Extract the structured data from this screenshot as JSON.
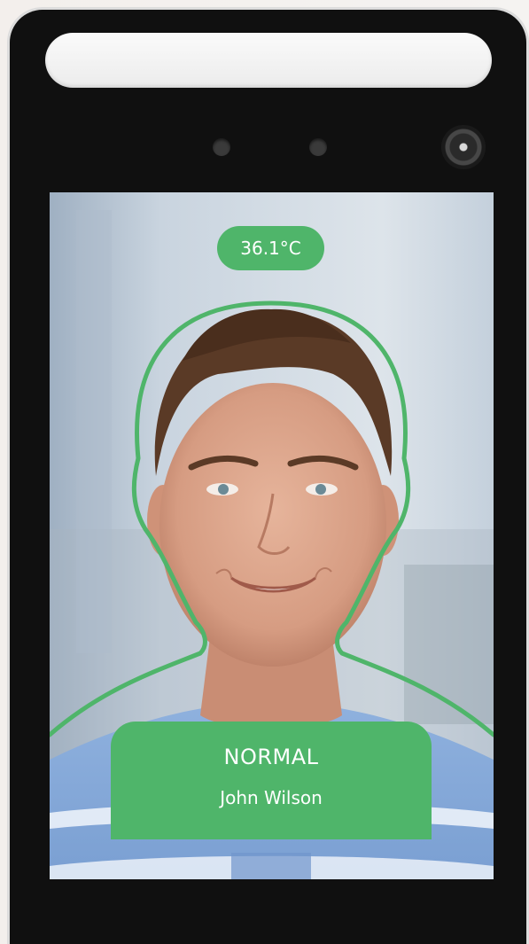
{
  "device": {
    "temperature": "36.1°C",
    "status": "NORMAL",
    "person_name": "John Wilson"
  },
  "colors": {
    "accent_green": "#4fb56a",
    "bezel": "#101010"
  },
  "icons": {
    "camera": "camera-lens-icon",
    "ir_sensor": "ir-sensor-dot-icon"
  }
}
